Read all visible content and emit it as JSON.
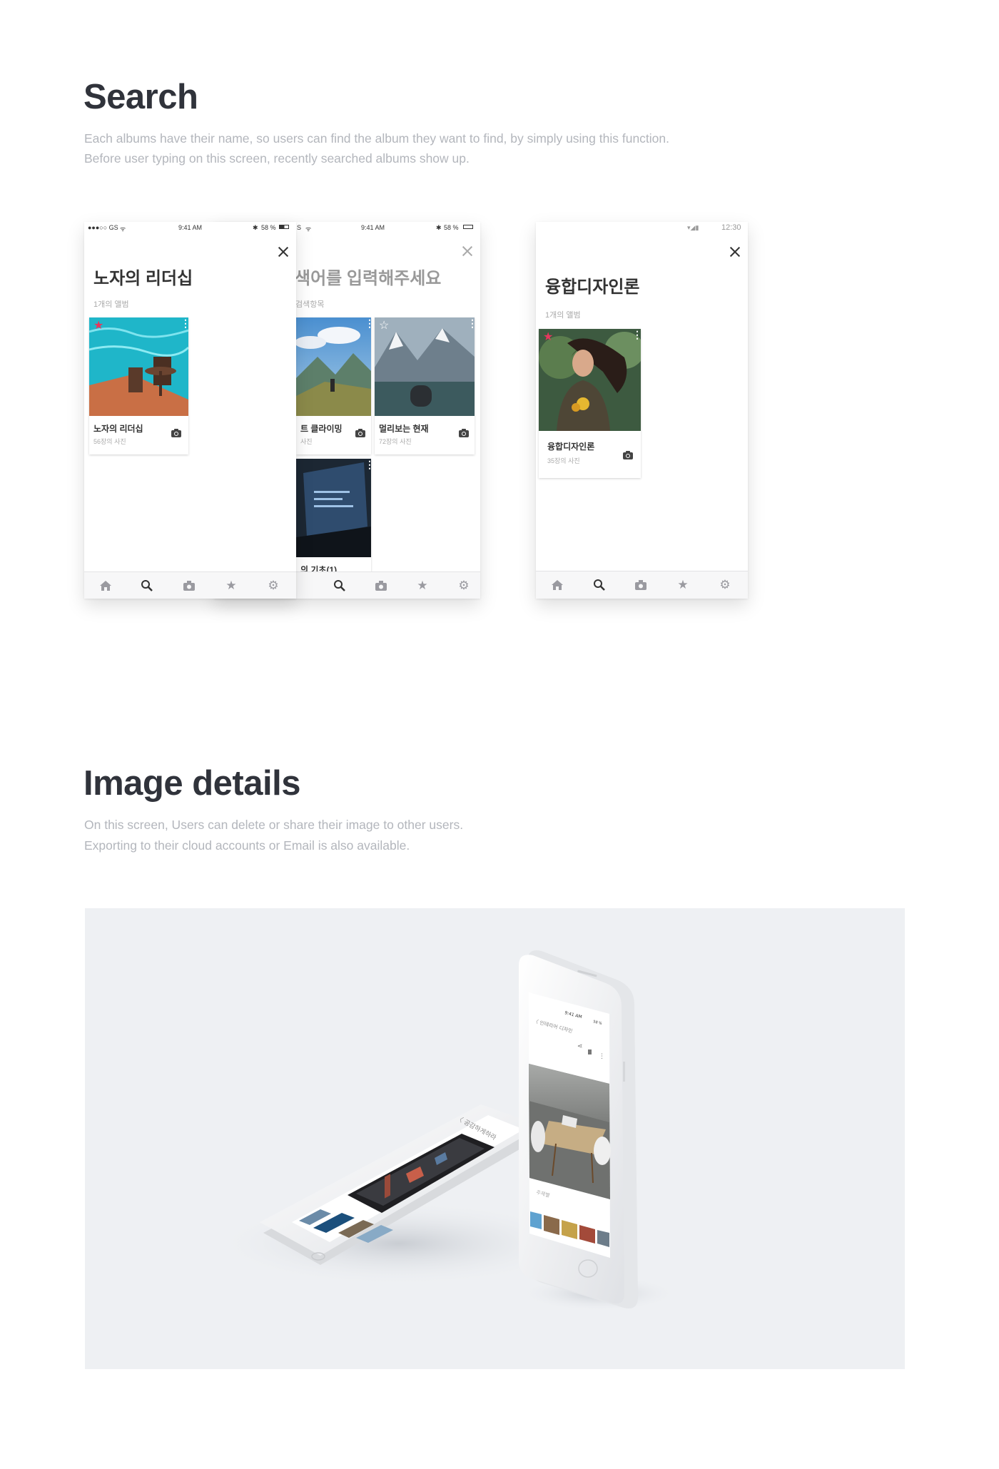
{
  "search": {
    "title": "Search",
    "desc_line1": "Each albums have their name, so users can find the album they want to find, by simply using this function.",
    "desc_line2": "Before user typing on this screen, recently searched albums show up."
  },
  "screen1": {
    "status_carrier": "●●●○○ GS",
    "status_time": "9:41 AM",
    "status_battery": "58 %",
    "title": "노자의 리더십",
    "subtitle": "1개의 앨범",
    "album": {
      "name": "노자의 리더십",
      "count": "56장의 사진"
    }
  },
  "screen2": {
    "status_carrier": "S",
    "status_time": "9:41 AM",
    "status_battery": "58 %",
    "placeholder": "색어를 입력해주세요",
    "subtitle": "검색항목",
    "albums": [
      {
        "name": "트 클라이밍",
        "count": "사진"
      },
      {
        "name": "멀리보는 현재",
        "count": "72장의 사진"
      },
      {
        "name": "의 기초(1)",
        "count": ""
      }
    ]
  },
  "screen3": {
    "status_time": "12:30",
    "title": "융합디자인론",
    "subtitle": "1개의 앨범",
    "album": {
      "name": "융합디자인론",
      "count": "35장의 사진"
    }
  },
  "tabs": [
    {
      "icon": "home-icon"
    },
    {
      "icon": "search-icon"
    },
    {
      "icon": "camera-icon"
    },
    {
      "icon": "star-icon"
    },
    {
      "icon": "gear-icon"
    }
  ],
  "details": {
    "title": "Image details",
    "desc_line1": "On this screen, Users can delete or share their image to other users.",
    "desc_line2": "Exporting to their cloud accounts or Email is also available."
  },
  "mockup": {
    "landscape_back_label": "〈 공감하게하라",
    "portrait_back_label": "〈 인테리어 디자인",
    "portrait_status_time": "9:41 AM",
    "portrait_status_battery": "58 %",
    "portrait_section_label": "주제별"
  },
  "colors": {
    "accent_star": "#e8365d",
    "title_text": "#30333b",
    "desc_text": "#b3b6bc",
    "mockup_bg": "#eef0f3"
  }
}
